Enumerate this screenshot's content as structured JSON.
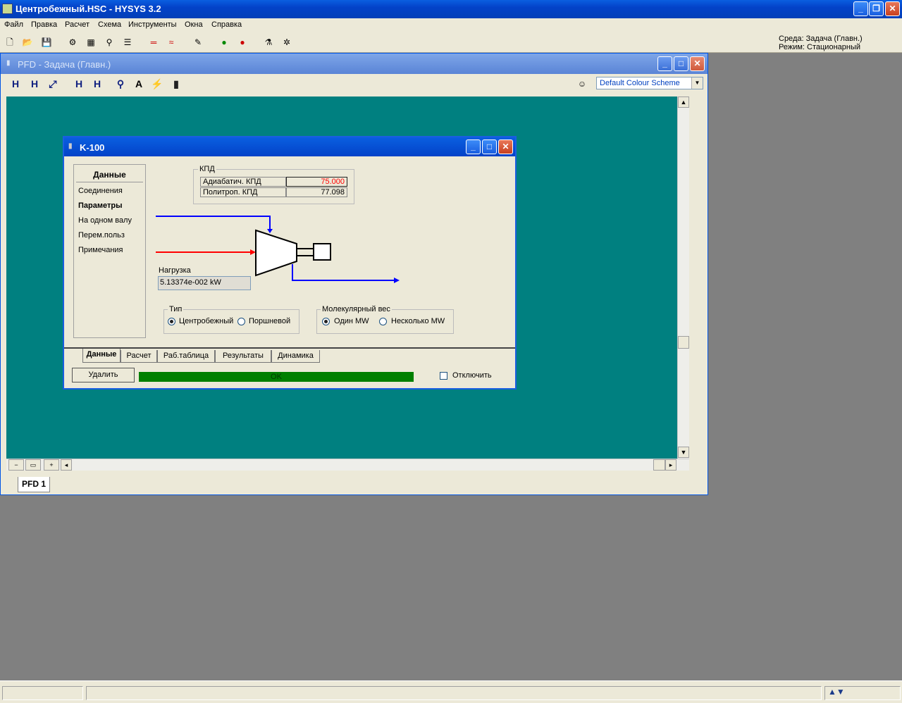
{
  "app": {
    "title": "Центробежный.HSC - HYSYS 3.2"
  },
  "menu": [
    "Файл",
    "Правка",
    "Расчет",
    "Схема",
    "Инструменты",
    "Окна",
    "Справка"
  ],
  "env": {
    "line1": "Среда: Задача (Главн.)",
    "line2": "Режим: Стационарный"
  },
  "pfd": {
    "title": "PFD - Задача (Главн.)",
    "scheme": "Default Colour Scheme",
    "tab": "PFD 1"
  },
  "dialog": {
    "title": "K-100",
    "nav": {
      "header": "Данные",
      "items": [
        "Соединения",
        "Параметры",
        "На одном валу",
        "Перем.польз",
        "Примечания"
      ]
    },
    "kpd": {
      "legend": "КПД",
      "rows": [
        {
          "label": "Адиабатич. КПД",
          "value": "75.000"
        },
        {
          "label": "Политроп. КПД",
          "value": "77.098"
        }
      ]
    },
    "load": {
      "label": "Нагрузка",
      "value": "5.13374e-002 kW"
    },
    "type": {
      "legend": "Тип",
      "opt1": "Центробежный",
      "opt2": "Поршневой"
    },
    "mw": {
      "legend": "Молекулярный вес",
      "opt1": "Один MW",
      "opt2": "Несколько MW"
    },
    "tabs": [
      "Данные",
      "Расчет",
      "Раб.таблица",
      "Результаты",
      "Динамика"
    ],
    "delete": "Удалить",
    "status": "OK",
    "ignore": "Отключить"
  },
  "colors": {
    "canvas": "#008080",
    "kpd_highlight": "#ff0000",
    "status_ok": "#007f00"
  }
}
